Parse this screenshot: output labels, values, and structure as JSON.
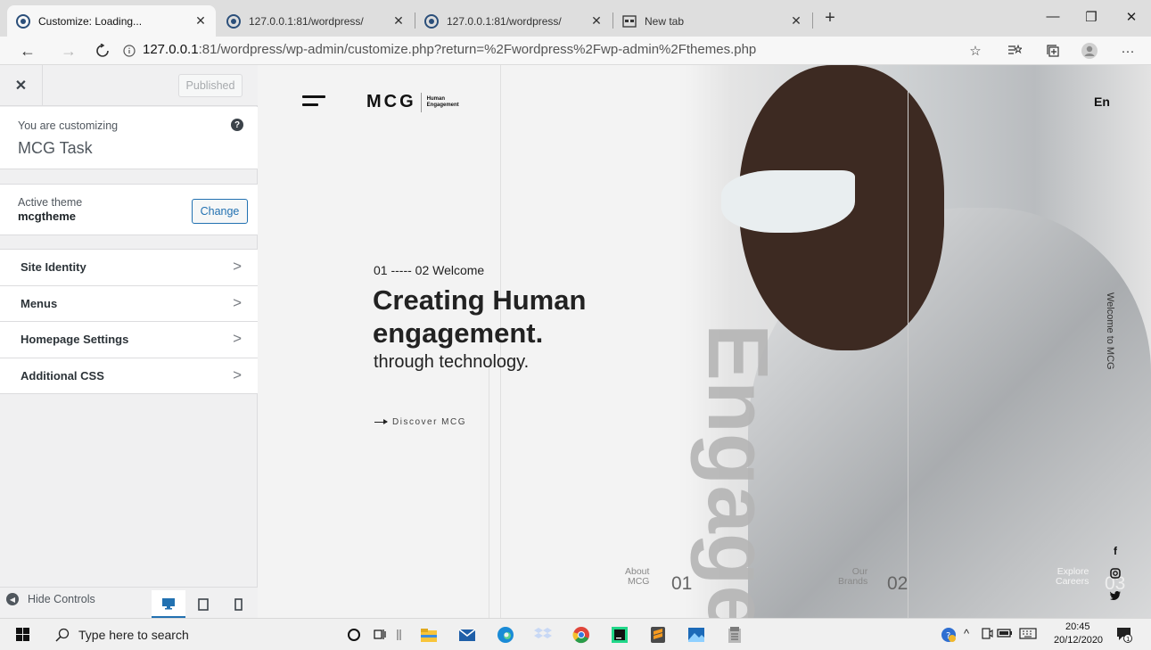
{
  "browser": {
    "tabs": [
      {
        "title": "Customize: Loading...",
        "active": true
      },
      {
        "title": "127.0.0.1:81/wordpress/",
        "active": false
      },
      {
        "title": "127.0.0.1:81/wordpress/",
        "active": false
      },
      {
        "title": "New tab",
        "active": false
      }
    ],
    "url_host": "127.0.0.1",
    "url_rest": ":81/wordpress/wp-admin/customize.php?return=%2Fwordpress%2Fwp-admin%2Fthemes.php"
  },
  "customizer": {
    "published_label": "Published",
    "customizing_label": "You are customizing",
    "site_title": "MCG Task",
    "active_theme_label": "Active theme",
    "theme_name": "mcgtheme",
    "change_label": "Change",
    "panels": [
      "Site Identity",
      "Menus",
      "Homepage Settings",
      "Additional CSS"
    ],
    "hide_controls_label": "Hide Controls"
  },
  "preview": {
    "logo_main": "MCG",
    "logo_sub_1": "Human",
    "logo_sub_2": "Engagement",
    "lang": "En",
    "kicker": "01 ----- 02 Welcome",
    "title_line1": "Creating Human",
    "title_line2": "engagement.",
    "subtitle": "through technology.",
    "discover": "Discover MCG",
    "big_word": "Engage",
    "side_text": "Welcome to MCG",
    "nav": [
      {
        "line1": "About",
        "line2": "MCG",
        "num": "01"
      },
      {
        "line1": "Our",
        "line2": "Brands",
        "num": "02"
      },
      {
        "line1": "Explore",
        "line2": "Careers",
        "num": "03"
      }
    ]
  },
  "taskbar": {
    "search_placeholder": "Type here to search",
    "time": "20:45",
    "date": "20/12/2020"
  },
  "colors": {
    "wp_blue": "#2271b1",
    "sidebar_bg": "#f0f0f1",
    "preview_bg": "#f3f3f3"
  }
}
